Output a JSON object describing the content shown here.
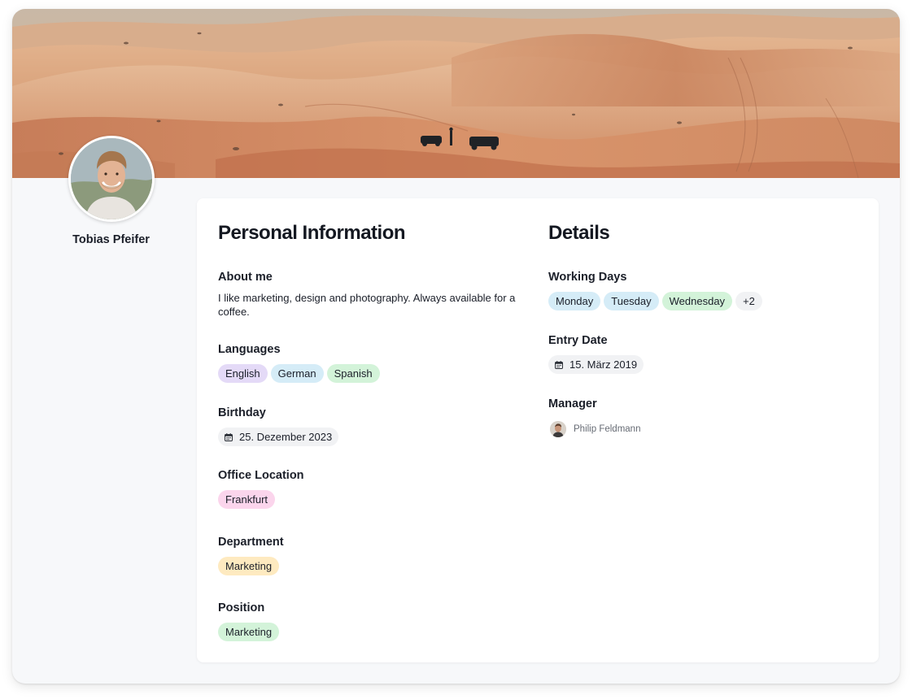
{
  "profile": {
    "name": "Tobias Pfeifer",
    "avatar_icon": "person-avatar",
    "cover_icon": "desert-landscape-image"
  },
  "personal": {
    "heading": "Personal Information",
    "about": {
      "label": "About me",
      "text": "I like marketing, design and photography. Always available for a coffee."
    },
    "languages": {
      "label": "Languages",
      "items": [
        "English",
        "German",
        "Spanish"
      ]
    },
    "birthday": {
      "label": "Birthday",
      "value": "25. Dezember 2023",
      "icon": "calendar-icon"
    },
    "office_location": {
      "label": "Office Location",
      "value": "Frankfurt"
    },
    "department": {
      "label": "Department",
      "value": "Marketing"
    },
    "position": {
      "label": "Position",
      "value": "Marketing"
    }
  },
  "details": {
    "heading": "Details",
    "working_days": {
      "label": "Working Days",
      "items": [
        "Monday",
        "Tuesday",
        "Wednesday"
      ],
      "more": "+2"
    },
    "entry_date": {
      "label": "Entry Date",
      "value": "15. März 2019",
      "icon": "calendar-icon"
    },
    "manager": {
      "label": "Manager",
      "name": "Philip Feldmann"
    }
  },
  "colors": {
    "page_bg": "#f7f8fa",
    "card_bg": "#ffffff",
    "text": "#1b1f29",
    "muted": "#666b74",
    "pill_purple": "#e4daf7",
    "pill_blue": "#d5ecf7",
    "pill_green": "#d3f3d9",
    "pill_pink": "#fbd5ec",
    "pill_yellow": "#feeac0",
    "pill_gray": "#f1f2f4"
  }
}
